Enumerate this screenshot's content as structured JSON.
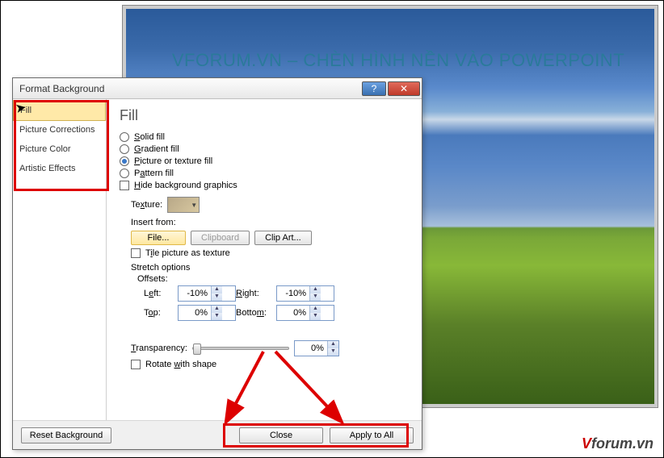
{
  "slide": {
    "title": "VFORUM.VN – CHÈN HÌNH NỀN VÀO POWERPOINT"
  },
  "watermark": {
    "v": "V",
    "rest": "forum.vn"
  },
  "dialog": {
    "title": "Format Background",
    "help_symbol": "?",
    "close_symbol": "✕",
    "sidebar": {
      "items": [
        {
          "label": "Fill",
          "selected": true
        },
        {
          "label": "Picture Corrections",
          "selected": false
        },
        {
          "label": "Picture Color",
          "selected": false
        },
        {
          "label": "Artistic Effects",
          "selected": false
        }
      ]
    },
    "main": {
      "heading": "Fill",
      "radios": {
        "solid": "Solid fill",
        "gradient": "Gradient fill",
        "picture": "Picture or texture fill",
        "pattern": "Pattern fill"
      },
      "hide_bg": "Hide background graphics",
      "texture_label": "Texture:",
      "insert_from": "Insert from:",
      "buttons": {
        "file": "File...",
        "clipboard": "Clipboard",
        "clipart": "Clip Art..."
      },
      "tile": "Tile picture as texture",
      "stretch": "Stretch options",
      "offsets_label": "Offsets:",
      "offsets": {
        "left_label": "Left:",
        "left_value": "-10%",
        "right_label": "Right:",
        "right_value": "-10%",
        "top_label": "Top:",
        "top_value": "0%",
        "bottom_label": "Bottom:",
        "bottom_value": "0%"
      },
      "transparency_label": "Transparency:",
      "transparency_value": "0%",
      "rotate": "Rotate with shape"
    },
    "footer": {
      "reset": "Reset Background",
      "close": "Close",
      "apply": "Apply to All"
    }
  }
}
